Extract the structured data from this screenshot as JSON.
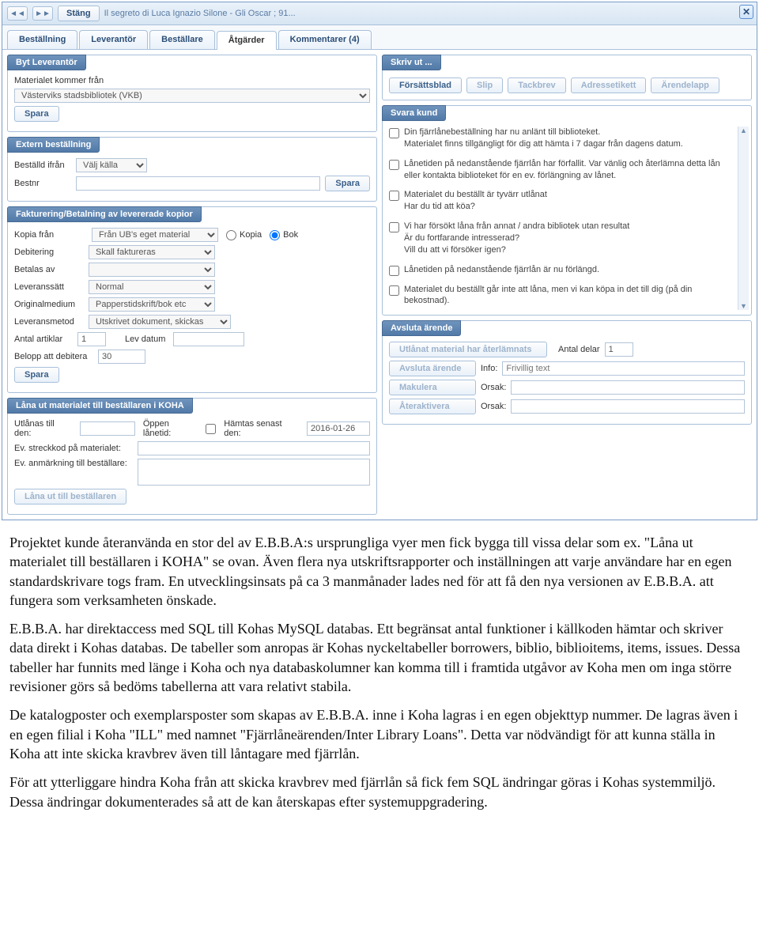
{
  "header": {
    "close_label": "Stäng",
    "title": "Il segreto di Luca Ignazio Silone - Gli Oscar ; 91..."
  },
  "tabs": {
    "t0": "Beställning",
    "t1": "Leverantör",
    "t2": "Beställare",
    "t3": "Åtgärder",
    "t4": "Kommentarer (4)"
  },
  "left": {
    "byt": {
      "legend": "Byt Leverantör",
      "from_label": "Materialet kommer från",
      "from_value": "Västerviks stadsbibliotek (VKB)",
      "save": "Spara"
    },
    "extern": {
      "legend": "Extern beställning",
      "bestalld_label": "Beställd ifrån",
      "bestalld_value": "Välj källa",
      "bestnr_label": "Bestnr",
      "save": "Spara"
    },
    "fakt": {
      "legend": "Fakturering/Betalning av levererade kopior",
      "kopia_label": "Kopia från",
      "kopia_value": "Från UB's eget material",
      "radio_kopia": "Kopia",
      "radio_bok": "Bok",
      "deb_label": "Debitering",
      "deb_value": "Skall faktureras",
      "betalas_label": "Betalas av",
      "levsatt_label": "Leveranssätt",
      "levsatt_value": "Normal",
      "orig_label": "Originalmedium",
      "orig_value": "Papperstidskrift/bok etc",
      "levmet_label": "Leveransmetod",
      "levmet_value": "Utskrivet dokument, skickas",
      "antal_label": "Antal artiklar",
      "antal_value": "1",
      "levdatum_label": "Lev datum",
      "belopp_label": "Belopp att debitera",
      "belopp_value": "30",
      "save": "Spara"
    },
    "lana": {
      "legend": "Låna ut materialet till beställaren i KOHA",
      "utlanas_label": "Utlånas till den:",
      "oppen_label": "Öppen lånetid:",
      "hamtas_label": "Hämtas senast den:",
      "hamtas_value": "2016-01-26",
      "streck_label": "Ev. streckkod på materialet:",
      "anm_label": "Ev. anmärkning till beställare:",
      "lana_btn": "Låna ut till beställaren"
    }
  },
  "right": {
    "skriv": {
      "legend": "Skriv ut ...",
      "b0": "Försättsblad",
      "b1": "Slip",
      "b2": "Tackbrev",
      "b3": "Adressetikett",
      "b4": "Ärendelapp"
    },
    "svara": {
      "legend": "Svara kund",
      "m0": "Din fjärrlånebeställning har nu anlänt till biblioteket.\nMaterialet finns tillgängligt för dig att hämta i 7 dagar från dagens datum.",
      "m1": "Lånetiden på nedanstående fjärrlån har förfallit. Var vänlig och återlämna detta lån eller kontakta biblioteket för en ev. förlängning av lånet.",
      "m2": "Materialet du beställt är tyvärr utlånat\nHar du tid att köa?",
      "m3": "Vi har försökt låna från annat / andra bibliotek utan resultat\nÄr du fortfarande intresserad?\nVill du att vi försöker igen?",
      "m4": "Lånetiden på nedanstående fjärrlån är nu förlängd.",
      "m5": "Materialet du beställt går inte att låna, men vi kan köpa in det till dig (på din bekostnad)."
    },
    "avsluta": {
      "legend": "Avsluta ärende",
      "b_return": "Utlånat material har återlämnats",
      "antal_delar_label": "Antal delar",
      "antal_delar_value": "1",
      "b_avsluta": "Avsluta ärende",
      "info_label": "Info:",
      "info_ph": "Frivillig text",
      "b_mak": "Makulera",
      "orsak_label": "Orsak:",
      "b_react": "Återaktivera"
    }
  },
  "prose": {
    "p1": "Projektet kunde återanvända en stor del av E.B.B.A:s ursprungliga vyer men fick bygga till vissa delar som ex. \"Låna ut materialet till beställaren i KOHA\" se ovan. Även flera nya utskriftsrapporter och inställningen att varje användare har en egen standardskrivare togs fram. En utvecklingsinsats på ca 3 manmånader lades ned för att få den nya versionen av E.B.B.A. att fungera som verksamheten önskade.",
    "p2": "E.B.B.A. har direktaccess med SQL till Kohas MySQL databas. Ett begränsat antal funktioner i källkoden hämtar och skriver data direkt i Kohas databas. De tabeller som anropas är Kohas nyckeltabeller borrowers, biblio, biblioitems, items, issues. Dessa tabeller har funnits med länge i Koha och nya databaskolumner kan komma till i framtida utgåvor av Koha men om inga större revisioner görs så bedöms tabellerna att vara relativt stabila.",
    "p3": "De katalogposter och exemplarsposter som skapas av E.B.B.A. inne i Koha lagras i en egen objekttyp nummer. De lagras även i en egen filial i Koha \"ILL\" med namnet \"Fjärrlåneärenden/Inter Library Loans\". Detta var nödvändigt för att kunna ställa in Koha att inte skicka kravbrev även till låntagare med fjärrlån.",
    "p4": "För att ytterliggare hindra Koha från att skicka kravbrev med fjärrlån så fick fem SQL ändringar göras i Kohas systemmiljö. Dessa ändringar dokumenterades så att de kan återskapas efter systemuppgradering."
  }
}
